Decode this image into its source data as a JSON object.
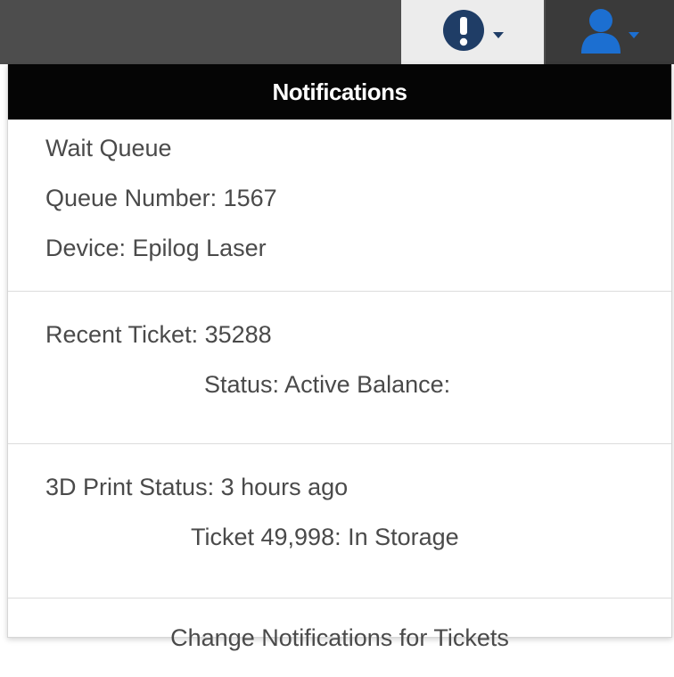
{
  "header": {
    "alert_icon": "exclamation-circle-icon",
    "user_icon": "user-icon",
    "accent_color": "#1c6fd1"
  },
  "notifications": {
    "title": "Notifications",
    "wait_queue": {
      "heading": "Wait Queue",
      "queue_number": "Queue Number: 1567",
      "device": "Device: Epilog Laser"
    },
    "recent_ticket": {
      "heading": "Recent Ticket: 35288",
      "status": "Status: Active Balance:"
    },
    "print_status": {
      "heading": "3D Print Status: 3 hours ago",
      "ticket": "Ticket 49,998: In Storage"
    },
    "footer_link": "Change Notifications for Tickets"
  }
}
